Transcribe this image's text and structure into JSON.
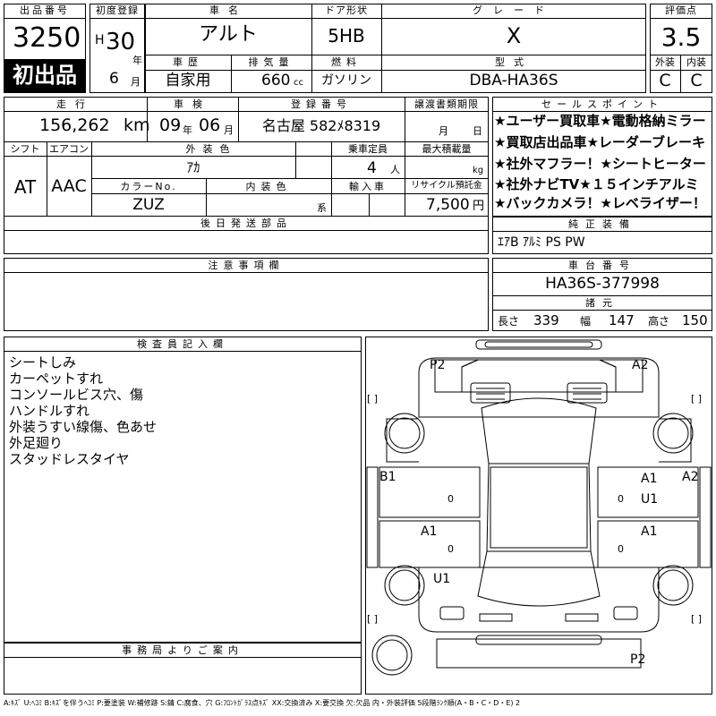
{
  "header": {
    "lot_label": "出品番号",
    "lot_number": "3250",
    "first_listing_banner": "初出品",
    "first_reg_label": "初度登録",
    "era": "H",
    "year": "30",
    "year_unit": "年",
    "month": "6",
    "month_unit": "月",
    "car_name_label": "車名",
    "car_name": "アルト",
    "door_label": "ドア形状",
    "door": "5HB",
    "grade_label": "グレード",
    "grade": "X",
    "score_label": "評価点",
    "score": "3.5",
    "history_label": "車歴",
    "history": "自家用",
    "displacement_label": "排気量",
    "displacement": "660",
    "displacement_unit": "cc",
    "fuel_label": "燃料",
    "fuel": "ガソリン",
    "model_label": "型式",
    "model": "DBA-HA36S",
    "exterior_label": "外装",
    "exterior_grade": "C",
    "interior_label": "内装",
    "interior_grade": "C"
  },
  "row2": {
    "mileage_label": "走行",
    "mileage": "156,262",
    "mileage_unit": "km",
    "inspection_label": "車検",
    "insp_year": "09",
    "insp_year_unit": "年",
    "insp_month": "06",
    "insp_month_unit": "月",
    "plate_label": "登録番号",
    "plate": "名古屋 582ﾒ8319",
    "transfer_label": "譲渡書類期限",
    "transfer_month_unit": "月",
    "transfer_day_unit": "日",
    "shift_label": "シフト",
    "shift": "AT",
    "ac_label": "エアコン",
    "ac": "AAC",
    "color_label": "外装色",
    "color": "ｱｶ",
    "capacity_label": "乗車定員",
    "capacity": "4",
    "capacity_unit": "人",
    "load_label": "最大積載量",
    "load_unit": "kg",
    "colorno_label": "カラーNo.",
    "colorno": "ZUZ",
    "interior_color_label": "内装色",
    "interior_color_unit": "系",
    "import_label": "輸入車",
    "recycle_label": "リサイクル預託金",
    "recycle": "7,500",
    "recycle_unit": "円",
    "later_parts_label": "後日発送部品"
  },
  "sales": {
    "label": "セールスポイント",
    "lines": [
      "★ユーザー買取車★電動格納ミラー",
      "★買取店出品車★レーダーブレーキ",
      "★社外マフラー！★シートヒーター",
      "★社外ナビTV★１５インチアルミ",
      "★バックカメラ！★レベライザー！"
    ]
  },
  "equipment": {
    "label": "純正装備",
    "value": "ｴｱB ｱﾙﾐ PS PW"
  },
  "caution": {
    "label": "注意事項欄"
  },
  "chassis": {
    "label": "車台番号",
    "value": "HA36S-377998",
    "specs_label": "諸元",
    "length_label": "長さ",
    "length": "339",
    "width_label": "幅",
    "width": "147",
    "height_label": "高さ",
    "height": "150"
  },
  "inspector": {
    "label": "検査員記入欄",
    "notes": [
      "シートしみ",
      "カーペットすれ",
      "コンソールビス穴、傷",
      "ハンドルすれ",
      "外装うすい線傷、色あせ",
      "外足廻り",
      "スタッドレスタイヤ"
    ]
  },
  "office": {
    "label": "事務局よりご案内"
  },
  "diagram": {
    "marks": {
      "p2_top": "P2",
      "a2_top": "A2",
      "b1": "B1",
      "a1_rf": "A1",
      "u1_r": "U1",
      "a2_r": "A2",
      "a1_l": "A1",
      "a1_rr": "A1",
      "u1_l": "U1",
      "p2_bottom": "P2"
    },
    "bracket": "[ ]",
    "zero": "0"
  },
  "legend": "A:ｷｽﾞ U:ﾍｺﾐ B:ｷｽﾞを伴うﾍｺﾐ P:要塗装 W:補修跡 S:錆 C:腐食、穴 G:ﾌﾛﾝﾄｶﾞﾗｽ点ｷｽﾞ XX:交換済み X:要交換 欠:欠品 内・外装評価 5段階ﾗﾝｸ順(A・B・C・D・E) 2"
}
